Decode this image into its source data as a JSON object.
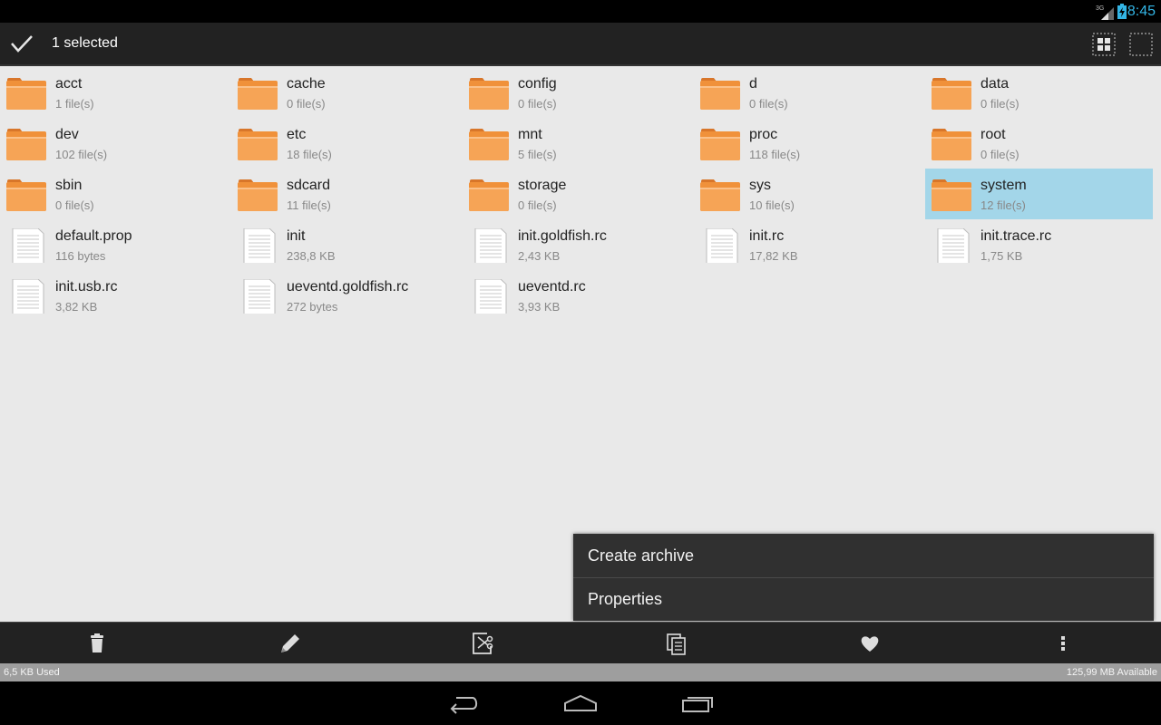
{
  "status_bar": {
    "time": "8:45",
    "network": "3G"
  },
  "action_bar": {
    "title": "1 selected",
    "icons": [
      "check-icon",
      "grid-view-icon",
      "select-all-icon"
    ]
  },
  "files": [
    {
      "name": "acct",
      "info": "1 file(s)",
      "type": "folder",
      "selected": false
    },
    {
      "name": "cache",
      "info": "0 file(s)",
      "type": "folder",
      "selected": false
    },
    {
      "name": "config",
      "info": "0 file(s)",
      "type": "folder",
      "selected": false
    },
    {
      "name": "d",
      "info": "0 file(s)",
      "type": "folder",
      "selected": false
    },
    {
      "name": "data",
      "info": "0 file(s)",
      "type": "folder",
      "selected": false
    },
    {
      "name": "dev",
      "info": "102 file(s)",
      "type": "folder",
      "selected": false
    },
    {
      "name": "etc",
      "info": "18 file(s)",
      "type": "folder",
      "selected": false
    },
    {
      "name": "mnt",
      "info": "5 file(s)",
      "type": "folder",
      "selected": false
    },
    {
      "name": "proc",
      "info": "118 file(s)",
      "type": "folder",
      "selected": false
    },
    {
      "name": "root",
      "info": "0 file(s)",
      "type": "folder",
      "selected": false
    },
    {
      "name": "sbin",
      "info": "0 file(s)",
      "type": "folder",
      "selected": false
    },
    {
      "name": "sdcard",
      "info": "11 file(s)",
      "type": "folder",
      "selected": false
    },
    {
      "name": "storage",
      "info": "0 file(s)",
      "type": "folder",
      "selected": false
    },
    {
      "name": "sys",
      "info": "10 file(s)",
      "type": "folder",
      "selected": false
    },
    {
      "name": "system",
      "info": "12 file(s)",
      "type": "folder",
      "selected": true
    },
    {
      "name": "default.prop",
      "info": "116 bytes",
      "type": "file",
      "selected": false
    },
    {
      "name": "init",
      "info": "238,8 KB",
      "type": "file",
      "selected": false
    },
    {
      "name": "init.goldfish.rc",
      "info": "2,43 KB",
      "type": "file",
      "selected": false
    },
    {
      "name": "init.rc",
      "info": "17,82 KB",
      "type": "file",
      "selected": false
    },
    {
      "name": "init.trace.rc",
      "info": "1,75 KB",
      "type": "file",
      "selected": false
    },
    {
      "name": "init.usb.rc",
      "info": "3,82 KB",
      "type": "file",
      "selected": false
    },
    {
      "name": "ueventd.goldfish.rc",
      "info": "272 bytes",
      "type": "file",
      "selected": false
    },
    {
      "name": "ueventd.rc",
      "info": "3,93 KB",
      "type": "file",
      "selected": false
    }
  ],
  "popup_menu": {
    "items": [
      "Create archive",
      "Properties"
    ]
  },
  "bottom_toolbar": {
    "icons": [
      "delete-icon",
      "rename-pencil-icon",
      "cut-icon",
      "copy-icon",
      "favorite-heart-icon",
      "overflow-menu-icon"
    ]
  },
  "storage": {
    "used": "6,5 KB Used",
    "available": "125,99 MB Available"
  },
  "nav_bar": {
    "icons": [
      "back-icon",
      "home-icon",
      "recents-icon"
    ]
  },
  "colors": {
    "accent": "#33b5e5",
    "selection": "#a3d6e9",
    "folder": "#f0913a",
    "toolbar": "#222222",
    "background": "#e9e9e9"
  }
}
